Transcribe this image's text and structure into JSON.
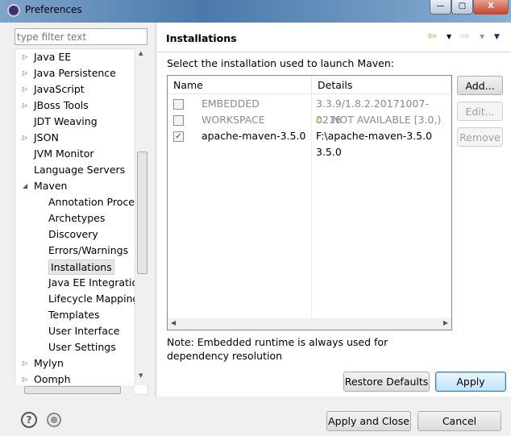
{
  "window": {
    "title": "Preferences",
    "minimize": "—",
    "maximize": "▢",
    "close": "X"
  },
  "sidebar": {
    "filter_placeholder": "type filter text",
    "items": [
      {
        "label": "Java EE",
        "level": 0,
        "arrow": "▷"
      },
      {
        "label": "Java Persistence",
        "level": 0,
        "arrow": "▷"
      },
      {
        "label": "JavaScript",
        "level": 0,
        "arrow": "▷"
      },
      {
        "label": "JBoss Tools",
        "level": 0,
        "arrow": "▷"
      },
      {
        "label": "JDT Weaving",
        "level": 0,
        "arrow": ""
      },
      {
        "label": "JSON",
        "level": 0,
        "arrow": "▷"
      },
      {
        "label": "JVM Monitor",
        "level": 0,
        "arrow": ""
      },
      {
        "label": "Language Servers",
        "level": 0,
        "arrow": ""
      },
      {
        "label": "Maven",
        "level": 0,
        "arrow": "◢"
      },
      {
        "label": "Annotation Processing",
        "level": 1,
        "arrow": ""
      },
      {
        "label": "Archetypes",
        "level": 1,
        "arrow": ""
      },
      {
        "label": "Discovery",
        "level": 1,
        "arrow": ""
      },
      {
        "label": "Errors/Warnings",
        "level": 1,
        "arrow": ""
      },
      {
        "label": "Installations",
        "level": 1,
        "arrow": "",
        "selected": true
      },
      {
        "label": "Java EE Integration",
        "level": 1,
        "arrow": ""
      },
      {
        "label": "Lifecycle Mappings",
        "level": 1,
        "arrow": ""
      },
      {
        "label": "Templates",
        "level": 1,
        "arrow": ""
      },
      {
        "label": "User Interface",
        "level": 1,
        "arrow": ""
      },
      {
        "label": "User Settings",
        "level": 1,
        "arrow": ""
      },
      {
        "label": "Mylyn",
        "level": 0,
        "arrow": "▷"
      },
      {
        "label": "Oomph",
        "level": 0,
        "arrow": "▷"
      }
    ]
  },
  "main": {
    "title": "Installations",
    "description": "Select the installation used to launch Maven:",
    "columns": [
      "Name",
      "Details"
    ],
    "rows": [
      {
        "name": "EMBEDDED",
        "details": "3.3.9/1.8.2.20171007-0216",
        "checked": false,
        "enabled": false,
        "warning": false
      },
      {
        "name": "WORKSPACE",
        "details": "NOT AVAILABLE [3.0,)",
        "checked": false,
        "enabled": false,
        "warning": true
      },
      {
        "name": "apache-maven-3.5.0",
        "details": "F:\\apache-maven-3.5.0 3.5.0",
        "checked": true,
        "enabled": true,
        "warning": false
      }
    ],
    "buttons": {
      "add": "Add...",
      "edit": "Edit...",
      "remove": "Remove"
    },
    "note": "Note: Embedded runtime is always used for dependency resolution",
    "restore_defaults": "Restore Defaults",
    "apply": "Apply"
  },
  "footer": {
    "apply_and_close": "Apply and Close",
    "cancel": "Cancel"
  }
}
